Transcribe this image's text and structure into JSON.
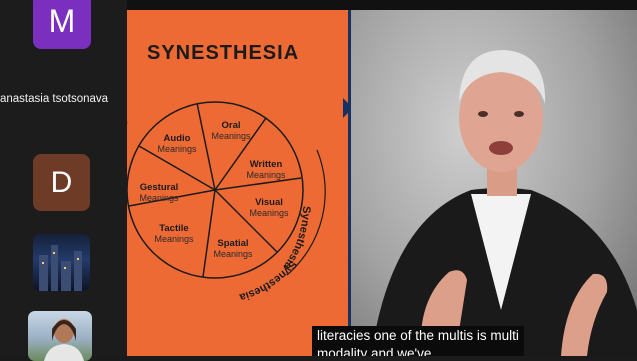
{
  "participants": {
    "tile_m_initial": "M",
    "name": "anastasia tsotsonava",
    "tile_d_initial": "D"
  },
  "slide": {
    "title": "SYNESTHESIA",
    "segments": [
      {
        "label": "Oral",
        "sub": "Meanings"
      },
      {
        "label": "Written",
        "sub": "Meanings"
      },
      {
        "label": "Visual",
        "sub": "Meanings"
      },
      {
        "label": "Spatial",
        "sub": "Meanings"
      },
      {
        "label": "Tactile",
        "sub": "Meanings"
      },
      {
        "label": "Gestural",
        "sub": "Meanings"
      },
      {
        "label": "Audio",
        "sub": "Meanings"
      }
    ],
    "arc_label_right": "Synesthesia",
    "arc_label_bottom": "Synesthesia",
    "arc_label_top_left": "ia"
  },
  "caption": {
    "line1": "literacies one of the multis is multi",
    "line2": "modality and we've"
  },
  "colors": {
    "slide_bg": "#ee6a35",
    "tile_m": "#7b2fbe",
    "tile_d": "#6d3b26",
    "divider": "#17325f"
  }
}
